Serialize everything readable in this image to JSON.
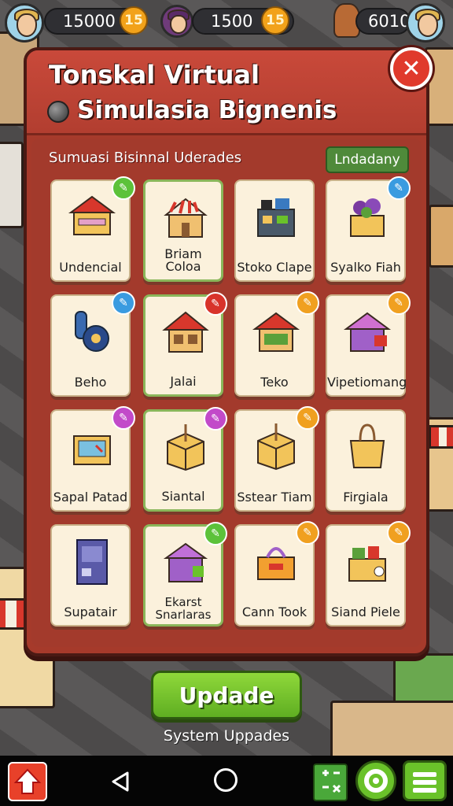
{
  "hud": {
    "coins": "15000",
    "coin_icon_label": "15",
    "gems": "1500",
    "gem_icon_label": "15",
    "tickets": "6010"
  },
  "modal": {
    "title_line1": "Tonskal Virtual",
    "title_line2": "Simulasia Bignenis",
    "close_label": "✕",
    "subtitle": "Sumuasi Bisinnal Uderades",
    "filter_button": "Lndadany"
  },
  "items": [
    {
      "label": "Undencial",
      "icon": "market-stall-icon",
      "badge": "green",
      "badge_color": "#5cc23a",
      "highlight": false
    },
    {
      "label": "Briam Coloa",
      "icon": "striped-shop-icon",
      "badge": "",
      "badge_color": "",
      "highlight": true
    },
    {
      "label": "Stoko Clape",
      "icon": "electronics-shop-icon",
      "badge": "",
      "badge_color": "",
      "highlight": false
    },
    {
      "label": "Syalko Fiah",
      "icon": "flower-box-icon",
      "badge": "blue",
      "badge_color": "#3a9be0",
      "highlight": false
    },
    {
      "label": "Beho",
      "icon": "pipe-machine-icon",
      "badge": "blue",
      "badge_color": "#3a9be0",
      "highlight": false
    },
    {
      "label": "Jalai",
      "icon": "red-roof-shop-icon",
      "badge": "red",
      "badge_color": "#d8332a",
      "highlight": true
    },
    {
      "label": "Teko",
      "icon": "green-shop-icon",
      "badge": "orange",
      "badge_color": "#f0a020",
      "highlight": false
    },
    {
      "label": "Vipetiomang",
      "icon": "purple-shop-icon",
      "badge": "orange",
      "badge_color": "#f0a020",
      "highlight": false
    },
    {
      "label": "Sapal Patad",
      "icon": "cash-register-icon",
      "badge": "purple",
      "badge_color": "#c24ac9",
      "highlight": false
    },
    {
      "label": "Siantal",
      "icon": "cardboard-box-icon",
      "badge": "purple",
      "badge_color": "#c24ac9",
      "highlight": true
    },
    {
      "label": "Sstear Tiam",
      "icon": "cardboard-box-icon",
      "badge": "orange",
      "badge_color": "#f0a020",
      "highlight": false
    },
    {
      "label": "Firgiala",
      "icon": "shopping-bag-icon",
      "badge": "",
      "badge_color": "",
      "highlight": false
    },
    {
      "label": "Supatair",
      "icon": "vending-machine-icon",
      "badge": "",
      "badge_color": "",
      "highlight": false
    },
    {
      "label": "Ekarst Snarlaras",
      "icon": "purple-box-shop-icon",
      "badge": "green",
      "badge_color": "#5cc23a",
      "highlight": true
    },
    {
      "label": "Cann Took",
      "icon": "crate-basket-icon",
      "badge": "orange",
      "badge_color": "#f0a020",
      "highlight": false
    },
    {
      "label": "Siand Piele",
      "icon": "plant-stand-icon",
      "badge": "orange",
      "badge_color": "#f0a020",
      "highlight": false
    }
  ],
  "footer": {
    "update_button": "Updade",
    "caption": "System Uppades"
  }
}
